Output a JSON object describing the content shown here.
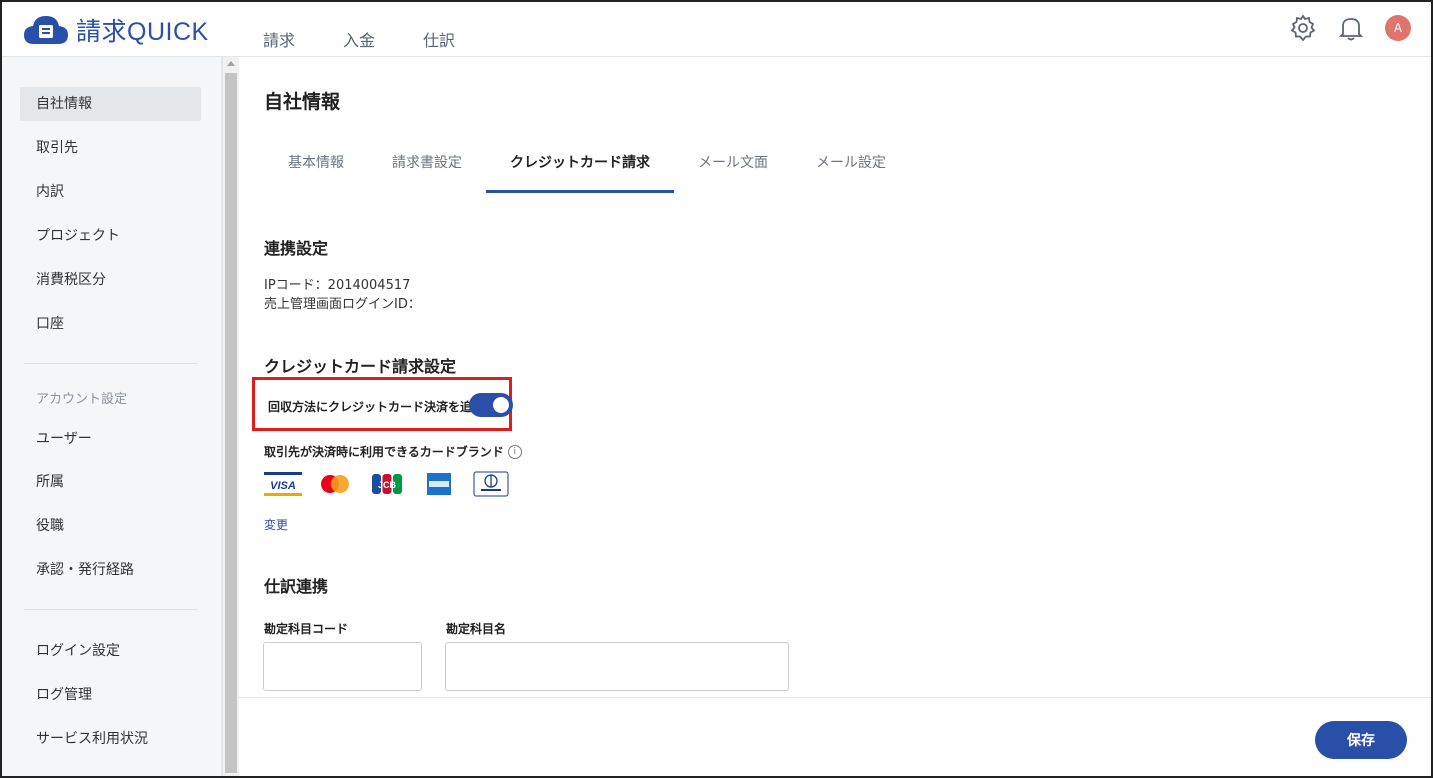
{
  "app": {
    "logo_text": "請求QUICK"
  },
  "topnav": {
    "items": [
      {
        "label": "請求"
      },
      {
        "label": "入金"
      },
      {
        "label": "仕訳"
      }
    ]
  },
  "header": {
    "icons": [
      "gear-icon",
      "bell-icon"
    ],
    "avatar_initial": "A",
    "avatar_color": "#e0736e"
  },
  "sidebar": {
    "group1": [
      {
        "label": "自社情報",
        "active": true
      },
      {
        "label": "取引先"
      },
      {
        "label": "内訳"
      },
      {
        "label": "プロジェクト"
      },
      {
        "label": "消費税区分"
      },
      {
        "label": "口座"
      }
    ],
    "account_heading": "アカウント設定",
    "group2": [
      {
        "label": "ユーザー"
      },
      {
        "label": "所属"
      },
      {
        "label": "役職"
      },
      {
        "label": "承認・発行経路"
      }
    ],
    "group3": [
      {
        "label": "ログイン設定"
      },
      {
        "label": "ログ管理"
      },
      {
        "label": "サービス利用状況"
      }
    ]
  },
  "main": {
    "title": "自社情報",
    "tabs": [
      {
        "label": "基本情報"
      },
      {
        "label": "請求書設定"
      },
      {
        "label": "クレジットカード請求",
        "active": true
      },
      {
        "label": "メール文面"
      },
      {
        "label": "メール設定"
      }
    ],
    "linkage": {
      "title": "連携設定",
      "ip_code": "IPコード：2014004517",
      "login_id": "売上管理画面ログインID："
    },
    "credit": {
      "title": "クレジットカード請求設定",
      "toggle_label": "回収方法にクレジットカード決済を追加",
      "toggle_on": true,
      "brands_label": "取引先が決済時に利用できるカードブランド",
      "brands": [
        {
          "icon": "visa-icon",
          "text": "VISA"
        },
        {
          "icon": "mastercard-icon",
          "text": ""
        },
        {
          "icon": "jcb-icon",
          "text": "JCB"
        },
        {
          "icon": "amex-icon",
          "text": ""
        },
        {
          "icon": "diners-icon",
          "text": ""
        }
      ],
      "change_link": "変更"
    },
    "journal": {
      "title": "仕訳連携",
      "code_label": "勘定科目コード",
      "name_label": "勘定科目名",
      "code_value": "",
      "name_value": ""
    }
  },
  "footer": {
    "save_label": "保存"
  },
  "colors": {
    "accent": "#2a4fa8",
    "highlight": "#e01d1d"
  }
}
